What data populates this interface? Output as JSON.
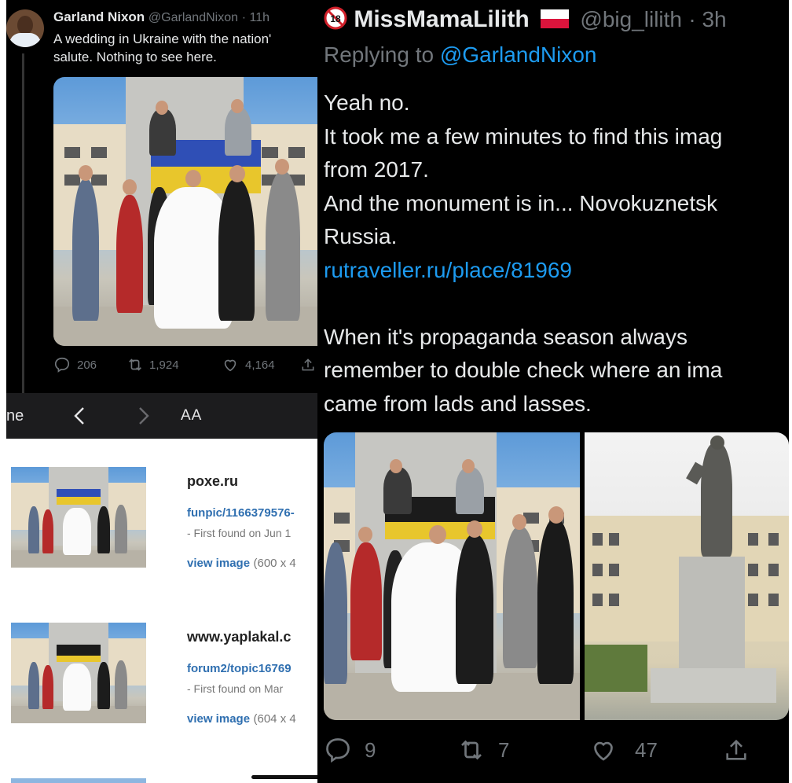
{
  "left_tweet": {
    "author_name": "Garland Nixon",
    "author_handle": "@GarlandNixon",
    "time": "· 11h",
    "text_line1": "A wedding in Ukraine with the nation'",
    "text_line2": "salute. Nothing to see here.",
    "replies": "206",
    "retweets": "1,924",
    "likes": "4,164"
  },
  "browser": {
    "toolbar_left_text": "ne",
    "aa_label": "AA",
    "results": [
      {
        "site": "poxe.ru",
        "link": "funpic/1166379576-",
        "found": "- First found on Jun 1",
        "view_label": "view image",
        "dims": "(600 x 4"
      },
      {
        "site": "www.yaplakal.c",
        "link": "forum2/topic16769",
        "found": "- First found on Mar",
        "view_label": "view image",
        "dims": "(604 x 4"
      }
    ]
  },
  "right_tweet": {
    "author_name": "MissMamaLilith",
    "author_handle": "@big_lilith",
    "time": "· 3h",
    "replying_prefix": "Replying to",
    "replying_to": "@GarlandNixon",
    "lines": [
      "Yeah no.",
      "It took me a few minutes to find this imag",
      "from 2017.",
      "And the monument is in... Novokuznetsk",
      "Russia."
    ],
    "link": "rutraveller.ru/place/81969",
    "lines2": [
      "When it's propaganda season always",
      "remember to double check where an ima",
      "came from lads and lasses."
    ],
    "replies": "9",
    "retweets": "7",
    "likes": "47"
  },
  "colors": {
    "tweet_bg": "#000000",
    "link_blue": "#1d9bf0",
    "muted_gray": "#71767b",
    "result_link_blue": "#2f6fb0"
  },
  "icons": [
    "reply-icon",
    "retweet-icon",
    "like-icon",
    "share-icon",
    "back-chevron-icon",
    "forward-chevron-icon",
    "adult-content-icon",
    "poland-flag-icon"
  ]
}
